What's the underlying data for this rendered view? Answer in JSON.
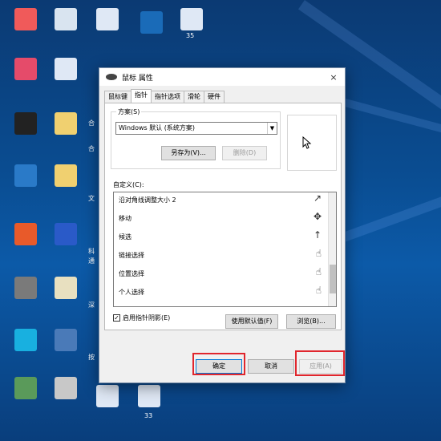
{
  "desktop": {
    "labels": [
      "35",
      "合",
      "合",
      "文",
      "科",
      "通",
      "深",
      "按",
      "33"
    ]
  },
  "dialog": {
    "title": "鼠标 属性",
    "close": "×",
    "tabs": [
      "鼠标键",
      "指针",
      "指针选项",
      "滑轮",
      "硬件"
    ],
    "active_tab": "指针",
    "scheme": {
      "legend": "方案(S)",
      "selected": "Windows 默认 (系统方案)",
      "save_as": "另存为(V)...",
      "delete": "删除(D)"
    },
    "customize_label": "自定义(C):",
    "pointer_rows": [
      {
        "label": "沿对角线调整大小 2",
        "icon": "↗"
      },
      {
        "label": "移动",
        "icon": "✥"
      },
      {
        "label": "候选",
        "icon": "↑"
      },
      {
        "label": "链接选择",
        "icon": "☝"
      },
      {
        "label": "位置选择",
        "icon": "☝"
      },
      {
        "label": "个人选择",
        "icon": "☝"
      }
    ],
    "enable_shadow": "启用指针阴影(E)",
    "use_default": "使用默认值(F)",
    "browse": "浏览(B)...",
    "ok": "确定",
    "cancel": "取消",
    "apply": "应用(A)"
  },
  "colors": {
    "highlight": "#e0262d"
  }
}
